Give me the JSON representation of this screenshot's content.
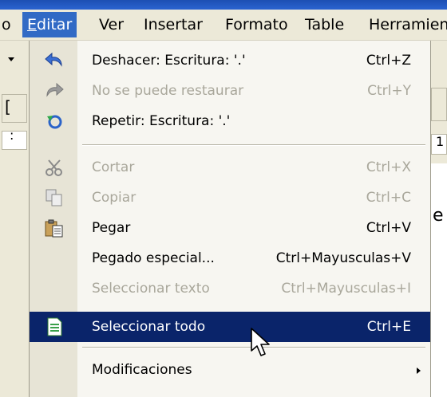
{
  "menubar": {
    "items": [
      {
        "label": "o"
      },
      {
        "label": "Editar"
      },
      {
        "label": "Ver"
      },
      {
        "label": "Insertar"
      },
      {
        "label": "Formato"
      },
      {
        "label": "Table"
      },
      {
        "label": "Herramien"
      }
    ]
  },
  "edit_menu": {
    "items": [
      {
        "label": "Deshacer: Escritura: '.'",
        "shortcut": "Ctrl+Z",
        "icon": "undo-icon"
      },
      {
        "label": "No se puede restaurar",
        "shortcut": "Ctrl+Y",
        "icon": "redo-icon"
      },
      {
        "label": "Repetir: Escritura: '.'",
        "shortcut": "",
        "icon": "repeat-icon"
      },
      {
        "label": "Cortar",
        "shortcut": "Ctrl+X",
        "icon": "scissors-icon"
      },
      {
        "label": "Copiar",
        "shortcut": "Ctrl+C",
        "icon": "copy-icon"
      },
      {
        "label": "Pegar",
        "shortcut": "Ctrl+V",
        "icon": "paste-icon"
      },
      {
        "label": "Pegado especial...",
        "shortcut": "Ctrl+Mayusculas+V",
        "icon": ""
      },
      {
        "label": "Seleccionar texto",
        "shortcut": "Ctrl+Mayusculas+I",
        "icon": ""
      },
      {
        "label": "Seleccionar todo",
        "shortcut": "Ctrl+E",
        "icon": "document-icon"
      },
      {
        "label": "Modificaciones",
        "shortcut": "",
        "icon": "submenu-arrow-icon"
      }
    ]
  },
  "background": {
    "edge_glyph_1": "[",
    "edge_glyph_2": "e",
    "edge_glyph_3": ":",
    "edge_glyph_4": "1"
  },
  "colors": {
    "menubar_bg": "#ece9d8",
    "highlight": "#0a246a",
    "active_menu": "#316ac5",
    "disabled_text": "#a9a79b"
  }
}
